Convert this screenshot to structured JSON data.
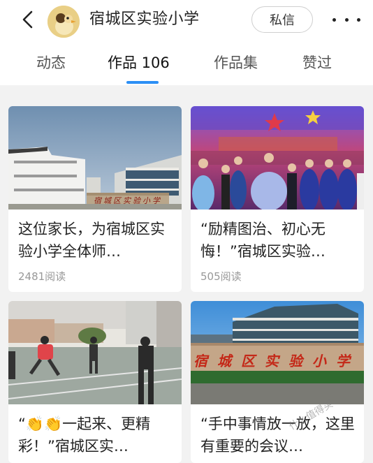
{
  "header": {
    "title": "宿城区实验小学",
    "message_button": "私信"
  },
  "icons": {
    "back": "chevron-left-icon",
    "more": "more-horizontal-icon"
  },
  "tabs": [
    {
      "label": "动态",
      "active": false
    },
    {
      "label": "作品 106",
      "active": true
    },
    {
      "label": "作品集",
      "active": false
    },
    {
      "label": "赞过",
      "active": false
    }
  ],
  "accent_color": "#2b8ff5",
  "cards": [
    {
      "caption": "这位家长，为宿城区实验小学全体师…",
      "reads": "2481阅读",
      "sign_text": "宿城区实验小学"
    },
    {
      "caption": "“励精图治、初心无悔！”宿城区实验…",
      "reads": "505阅读"
    },
    {
      "caption": "“👏👏一起来、更精彩！”宿城区实…",
      "reads": ""
    },
    {
      "caption": "“手中事情放一放，这里有重要的会议…",
      "reads": "",
      "sign_text": "宿城区实验小学"
    }
  ],
  "watermark": "什么值得买"
}
